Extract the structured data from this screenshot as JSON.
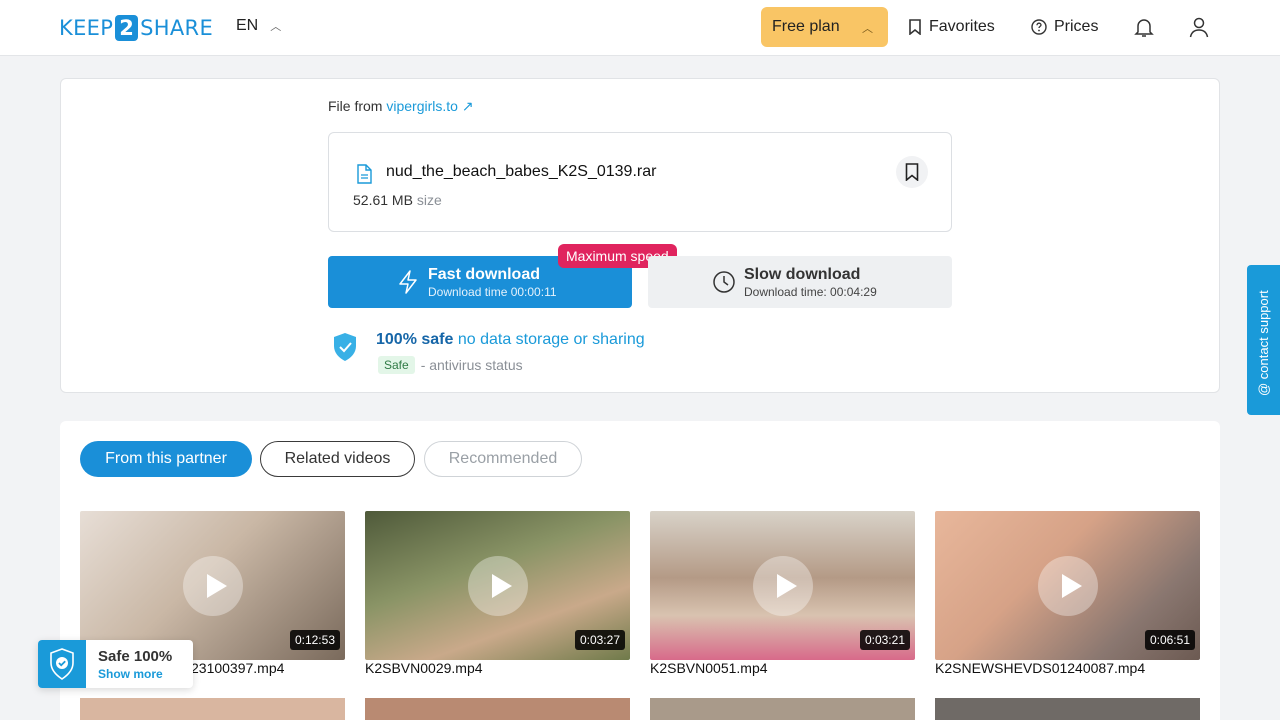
{
  "header": {
    "logo_left": "KEEP",
    "logo_mid": "2",
    "logo_right": "SHARE",
    "lang": "EN",
    "plan": "Free plan",
    "favorites": "Favorites",
    "prices": "Prices"
  },
  "file": {
    "from_label": "File from",
    "from_source": "vipergirls.to",
    "name": "nud_the_beach_babes_K2S_0139.rar",
    "size_value": "52.61 MB",
    "size_label": "size"
  },
  "download": {
    "badge": "Maximum speed",
    "fast_title": "Fast download",
    "fast_time": "Download time 00:00:11",
    "slow_title": "Slow download",
    "slow_time": "Download time: 00:04:29"
  },
  "safety": {
    "bold": "100% safe",
    "rest": "no data storage or sharing",
    "pill": "Safe",
    "status": "- antivirus status"
  },
  "tabs": [
    "From this partner",
    "Related videos",
    "Recommended"
  ],
  "videos": [
    {
      "name": "23100397.mp4",
      "duration": "0:12:53",
      "bg": "#c9b7a5"
    },
    {
      "name": "K2SBVN0029.mp4",
      "duration": "0:03:27",
      "bg": "#8a9466"
    },
    {
      "name": "K2SBVN0051.mp4",
      "duration": "0:03:21",
      "bg": "#b49a86"
    },
    {
      "name": "K2SNEWSHEVDS01240087.mp4",
      "duration": "0:06:51",
      "bg": "#d6a287"
    }
  ],
  "support": "@ contact support",
  "safe_widget": {
    "title": "Safe 100%",
    "link": "Show more"
  },
  "colors": {
    "accent": "#1a8fd8",
    "plan": "#f9c565",
    "badge": "#e0245e"
  }
}
